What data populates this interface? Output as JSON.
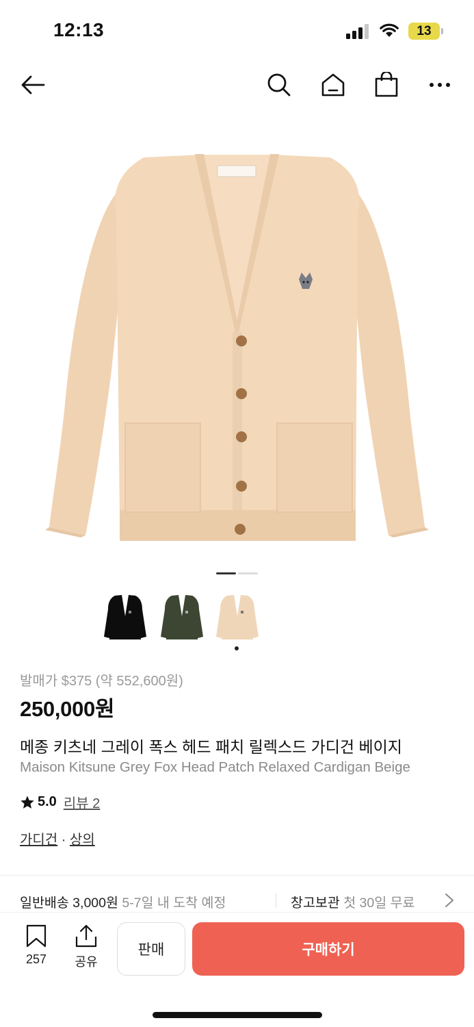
{
  "status_bar": {
    "time": "12:13",
    "battery": "13",
    "signal_icon": "cellular-signal-icon",
    "wifi_icon": "wifi-icon"
  },
  "nav": {
    "back_icon": "back-arrow-icon",
    "search_icon": "search-icon",
    "home_icon": "home-icon",
    "cart_icon": "shopping-bag-icon",
    "more_icon": "more-icon"
  },
  "gallery": {
    "current_index": 1,
    "total": 2,
    "thumbnails": [
      "black",
      "olive",
      "beige"
    ],
    "selected_thumbnail": 2
  },
  "product": {
    "release_price": "발매가 $375 (약 552,600원)",
    "price": "250,000원",
    "name_ko": "메종 키츠네 그레이 폭스 헤드 패치 릴렉스드 가디건 베이지",
    "name_en": "Maison Kitsune Grey Fox Head Patch Relaxed Cardigan Beige",
    "rating": "5.0",
    "reviews": "리뷰 2",
    "category_1": "가디건",
    "category_sep": " · ",
    "category_2": "상의"
  },
  "shipping": {
    "label": "일반배송 3,000원",
    "eta": "5-7일 내 도착 예정",
    "storage_label": "창고보관",
    "storage_detail": "첫 30일 무료"
  },
  "bottom_bar": {
    "bookmark_count": "257",
    "share_label": "공유",
    "sell_label": "판매",
    "buy_label": "구매하기"
  },
  "colors": {
    "accent": "#ef6253",
    "cardigan": "#f2d7b8",
    "muted_text": "#8f8f8f"
  }
}
